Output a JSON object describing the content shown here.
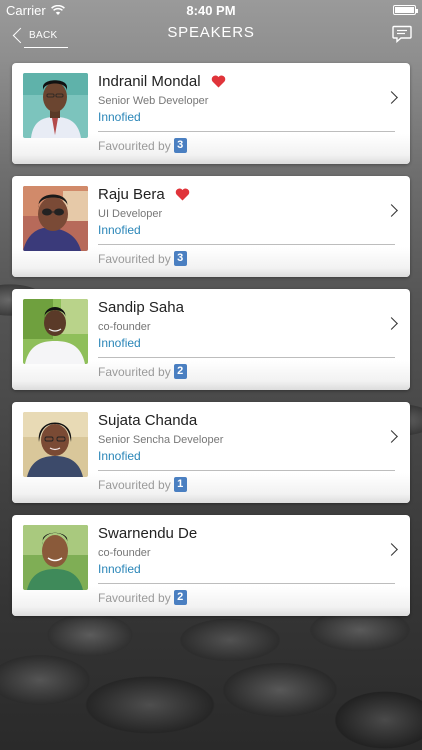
{
  "status": {
    "carrier": "Carrier",
    "time": "8:40 PM"
  },
  "nav": {
    "back_label": "BACK",
    "title": "SPEAKERS"
  },
  "speakers": [
    {
      "name": "Indranil Mondal",
      "role": "Senior Web Developer",
      "company": "Innofied",
      "favourited_label": "Favourited by",
      "favourited_count": "3",
      "favourited_by_me": true
    },
    {
      "name": "Raju Bera",
      "role": "UI Developer",
      "company": "Innofied",
      "favourited_label": "Favourited by",
      "favourited_count": "3",
      "favourited_by_me": true
    },
    {
      "name": "Sandip Saha",
      "role": "co-founder",
      "company": "Innofied",
      "favourited_label": "Favourited by",
      "favourited_count": "2",
      "favourited_by_me": false
    },
    {
      "name": "Sujata Chanda",
      "role": "Senior Sencha Developer",
      "company": "Innofied",
      "favourited_label": "Favourited by",
      "favourited_count": "1",
      "favourited_by_me": false
    },
    {
      "name": "Swarnendu De",
      "role": "co-founder",
      "company": "Innofied",
      "favourited_label": "Favourited by",
      "favourited_count": "2",
      "favourited_by_me": false
    }
  ],
  "colors": {
    "accent_link": "#2b86b8",
    "badge": "#4a7fc1",
    "heart": "#e0343a"
  }
}
